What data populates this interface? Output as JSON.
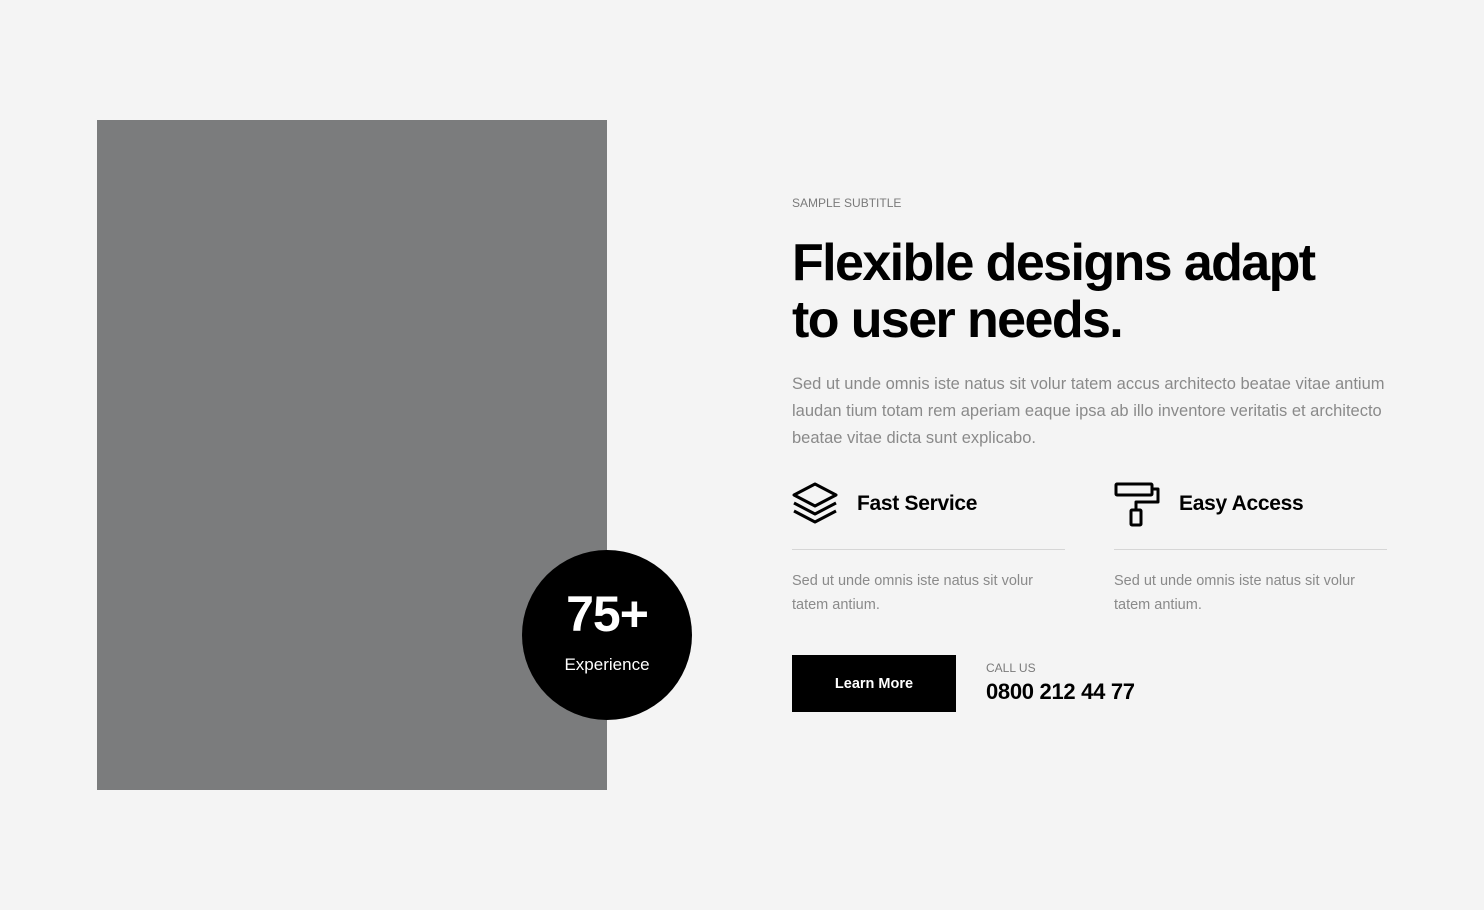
{
  "hero": {
    "subtitle": "SAMPLE SUBTITLE",
    "headline": "Flexible designs adapt to user needs.",
    "lead": "Sed ut unde omnis iste natus sit volur tatem accus architecto beatae vitae antium laudan tium totam rem aperiam eaque ipsa ab illo inventore veritatis et architecto beatae vitae dicta sunt explicabo."
  },
  "badge": {
    "number": "75+",
    "label": "Experience"
  },
  "features": [
    {
      "icon": "layers-icon",
      "title": "Fast Service",
      "text": "Sed ut unde omnis iste natus sit volur tatem antium."
    },
    {
      "icon": "paint-roller-icon",
      "title": "Easy Access",
      "text": "Sed ut unde omnis iste natus sit volur tatem antium."
    }
  ],
  "cta": {
    "button_label": "Learn More",
    "call_label": "CALL US",
    "phone": "0800 212 44 77"
  },
  "colors": {
    "background": "#f4f4f4",
    "image_placeholder": "#7b7c7d",
    "accent": "#000000",
    "muted_text": "#8a8a8a"
  }
}
